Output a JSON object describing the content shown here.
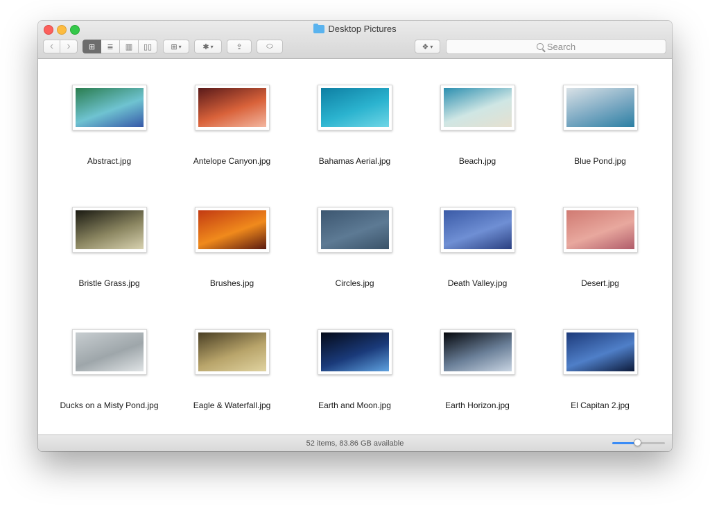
{
  "window": {
    "title": "Desktop Pictures",
    "folder_icon": "folder-icon"
  },
  "toolbar": {
    "back_glyph": "‹",
    "forward_glyph": "›",
    "views": [
      {
        "name": "icon-view",
        "glyph": "⊞",
        "active": true
      },
      {
        "name": "list-view",
        "glyph": "≣",
        "active": false
      },
      {
        "name": "column-view",
        "glyph": "▥",
        "active": false
      },
      {
        "name": "cover-flow-view",
        "glyph": "▯▯",
        "active": false
      }
    ],
    "arrange_glyph": "⊞",
    "action_glyph": "✱",
    "share_glyph": "⇪",
    "tag_glyph": "⬭",
    "dropbox_glyph": "❖",
    "search_placeholder": "Search"
  },
  "files": [
    {
      "name": "Abstract.jpg",
      "colors": [
        "#2a7d4f",
        "#6fc3d1",
        "#3558a8"
      ]
    },
    {
      "name": "Antelope Canyon.jpg",
      "colors": [
        "#5a1a1a",
        "#d9623a",
        "#f3b6a0"
      ]
    },
    {
      "name": "Bahamas Aerial.jpg",
      "colors": [
        "#0e7fa3",
        "#2bb3cf",
        "#6fd6e6"
      ]
    },
    {
      "name": "Beach.jpg",
      "colors": [
        "#2c8fb0",
        "#cfe6e4",
        "#e6e0cf"
      ]
    },
    {
      "name": "Blue Pond.jpg",
      "colors": [
        "#d9e1e6",
        "#7aa8c2",
        "#2b7fa3"
      ]
    },
    {
      "name": "Bristle Grass.jpg",
      "colors": [
        "#1a1a12",
        "#8a8560",
        "#d8d2b0"
      ]
    },
    {
      "name": "Brushes.jpg",
      "colors": [
        "#c23a12",
        "#f08a1c",
        "#5a1a10"
      ]
    },
    {
      "name": "Circles.jpg",
      "colors": [
        "#3c5670",
        "#5d7a94",
        "#3a5268"
      ]
    },
    {
      "name": "Death Valley.jpg",
      "colors": [
        "#3a5aa6",
        "#6f8fd4",
        "#2a3f80"
      ]
    },
    {
      "name": "Desert.jpg",
      "colors": [
        "#d07a72",
        "#e8a89e",
        "#b05c6a"
      ]
    },
    {
      "name": "Ducks on a Misty Pond.jpg",
      "colors": [
        "#c7cdd0",
        "#9ea6aa",
        "#dfe3e5"
      ]
    },
    {
      "name": "Eagle & Waterfall.jpg",
      "colors": [
        "#4a3f24",
        "#b8a46a",
        "#e0d3a0"
      ]
    },
    {
      "name": "Earth and Moon.jpg",
      "colors": [
        "#050a18",
        "#1a3a7a",
        "#5fa2e0"
      ]
    },
    {
      "name": "Earth Horizon.jpg",
      "colors": [
        "#05070c",
        "#6a7f98",
        "#c8d4e2"
      ]
    },
    {
      "name": "El Capitan 2.jpg",
      "colors": [
        "#1d3a7a",
        "#4f7fc8",
        "#0c1a3a"
      ]
    }
  ],
  "status": {
    "text": "52 items, 83.86 GB available",
    "zoom_level": 0.48
  }
}
